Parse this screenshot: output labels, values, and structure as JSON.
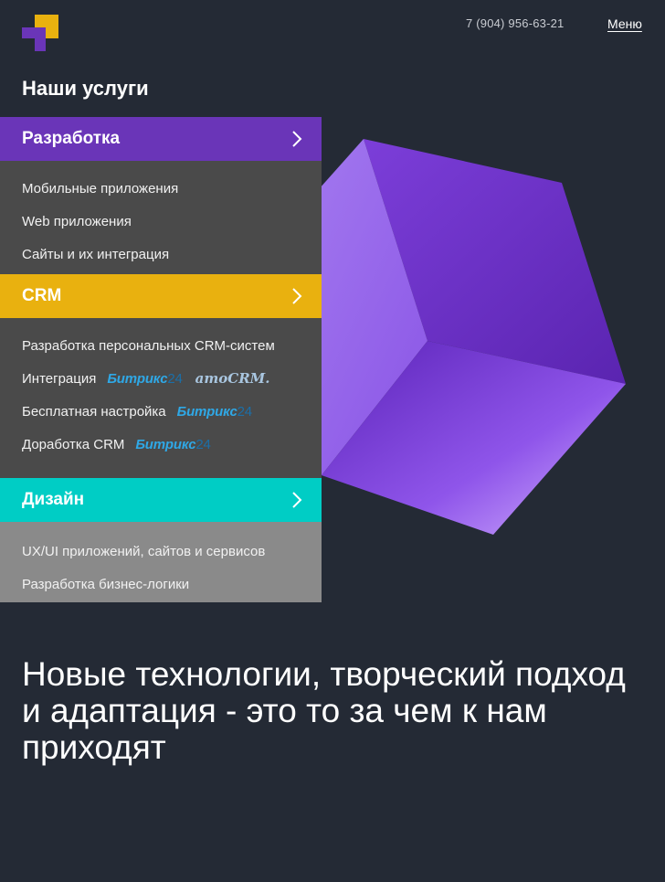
{
  "header": {
    "phone": "7 (904) 956-63-21",
    "menu_label": "Меню",
    "logo_colors": {
      "yellow": "#e9b10f",
      "purple": "#6a35b8"
    }
  },
  "services": {
    "title": "Наши услуги",
    "categories": [
      {
        "label": "Разработка",
        "color": "#6a35b8",
        "items": [
          {
            "label": "Мобильные приложения"
          },
          {
            "label": "Web приложения"
          },
          {
            "label": "Сайты и их интеграция"
          }
        ]
      },
      {
        "label": "CRM",
        "color": "#e9b10f",
        "items": [
          {
            "label": "Разработка персональных CRM-систем"
          },
          {
            "label": "Интеграция",
            "badges": [
              "Битрикс24",
              "amoCRM."
            ]
          },
          {
            "label": "Бесплатная настройка",
            "badges": [
              "Битрикс24"
            ]
          },
          {
            "label": "Доработка CRM",
            "badges": [
              "Битрикс24"
            ]
          }
        ]
      },
      {
        "label": "Дизайн",
        "color": "#00cdc5",
        "items": [
          {
            "label": "UX/UI приложений, сайтов и сервисов"
          },
          {
            "label": "Разработка бизнес-логики"
          }
        ]
      }
    ]
  },
  "badges": {
    "bitrix_word": "Битрикс",
    "bitrix_num": "24",
    "amocrm": "amoCRM."
  },
  "hero": {
    "headline": "Новые технологии, творческий подход и адаптация - это то за чем к нам приходят"
  },
  "icons": [
    "logo-icon",
    "chevron-right-icon",
    "cube-illustration"
  ]
}
